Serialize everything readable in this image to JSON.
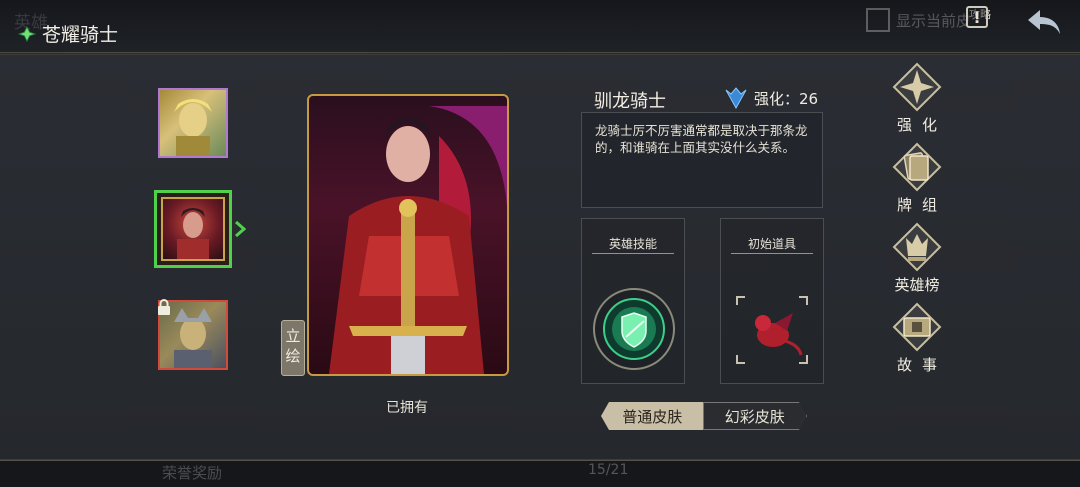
{
  "header": {
    "title": "苍耀骑士",
    "show_current_label": "显示当前皮",
    "guide_label": "攻略",
    "ghost_tab": "英雄"
  },
  "hero": {
    "name": "驯龙骑士",
    "enhance_label": "强化：26",
    "description": "龙骑士厉不厉害通常都是取决于那条龙的，和谁骑在上面其实没什么关系。",
    "owned_label": "已拥有",
    "art_tab": "立绘"
  },
  "panels": {
    "skill_title": "英雄技能",
    "item_title": "初始道具"
  },
  "skins": {
    "normal": "普通皮肤",
    "fancy": "幻彩皮肤"
  },
  "menu": {
    "enhance": "强化",
    "deck": "牌组",
    "ranking": "英雄榜",
    "story": "故事"
  },
  "footer": {
    "honor": "荣誉奖励",
    "page": "15/21"
  },
  "colors": {
    "selected_border": "#4fd24a",
    "locked_border": "#d24a3a",
    "rare_border": "#b07ad0",
    "gold_frame": "#c79a42"
  }
}
